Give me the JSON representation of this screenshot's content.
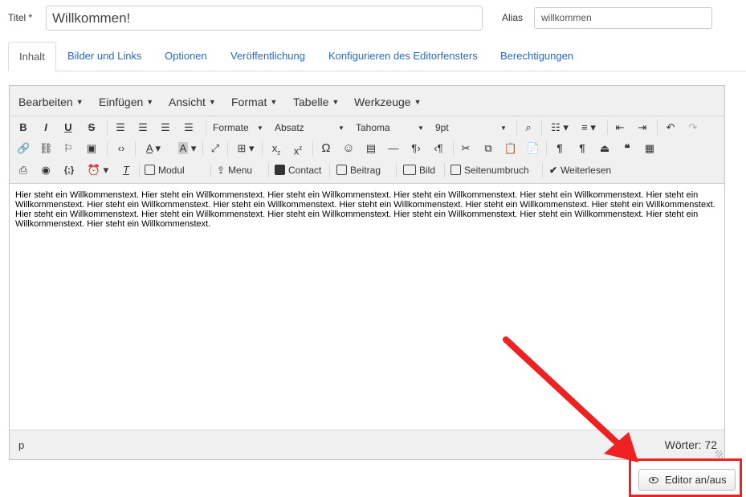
{
  "form": {
    "title_label": "Titel *",
    "title_value": "Willkommen!",
    "alias_label": "Alias",
    "alias_value": "willkommen"
  },
  "tabs": [
    {
      "label": "Inhalt",
      "active": true
    },
    {
      "label": "Bilder und Links"
    },
    {
      "label": "Optionen"
    },
    {
      "label": "Veröffentlichung"
    },
    {
      "label": "Konfigurieren des Editorfensters"
    },
    {
      "label": "Berechtigungen"
    }
  ],
  "menubar": [
    "Bearbeiten",
    "Einfügen",
    "Ansicht",
    "Format",
    "Tabelle",
    "Werkzeuge"
  ],
  "toolbar": {
    "formats_label": "Formate",
    "block_label": "Absatz",
    "font_label": "Tahoma",
    "size_label": "9pt",
    "buttons": {
      "modul": "Modul",
      "menu": "Menu",
      "contact": "Contact",
      "beitrag": "Beitrag",
      "bild": "Bild",
      "seitenumbruch": "Seitenumbruch",
      "weiterlesen": "Weiterlesen"
    }
  },
  "content": {
    "text": "Hier steht ein Willkommenstext. Hier steht ein Willkommenstext. Hier steht ein Willkommenstext. Hier steht ein Willkommenstext. Hier steht ein Willkommenstext. Hier steht ein Willkommenstext. Hier steht ein Willkommenstext. Hier steht ein Willkommenstext. Hier steht ein Willkommenstext. Hier steht ein Willkommenstext. Hier steht ein Willkommenstext. Hier steht ein Willkommenstext. Hier steht ein Willkommenstext. Hier steht ein Willkommenstext. Hier steht ein Willkommenstext. Hier steht ein Willkommenstext. Hier steht ein Willkommenstext. Hier steht ein Willkommenstext."
  },
  "statusbar": {
    "path": "p",
    "wordcount": "Wörter: 72"
  },
  "toggle_editor_label": "Editor an/aus",
  "colors": {
    "link": "#2a69b8",
    "highlight": "#ee2222"
  }
}
